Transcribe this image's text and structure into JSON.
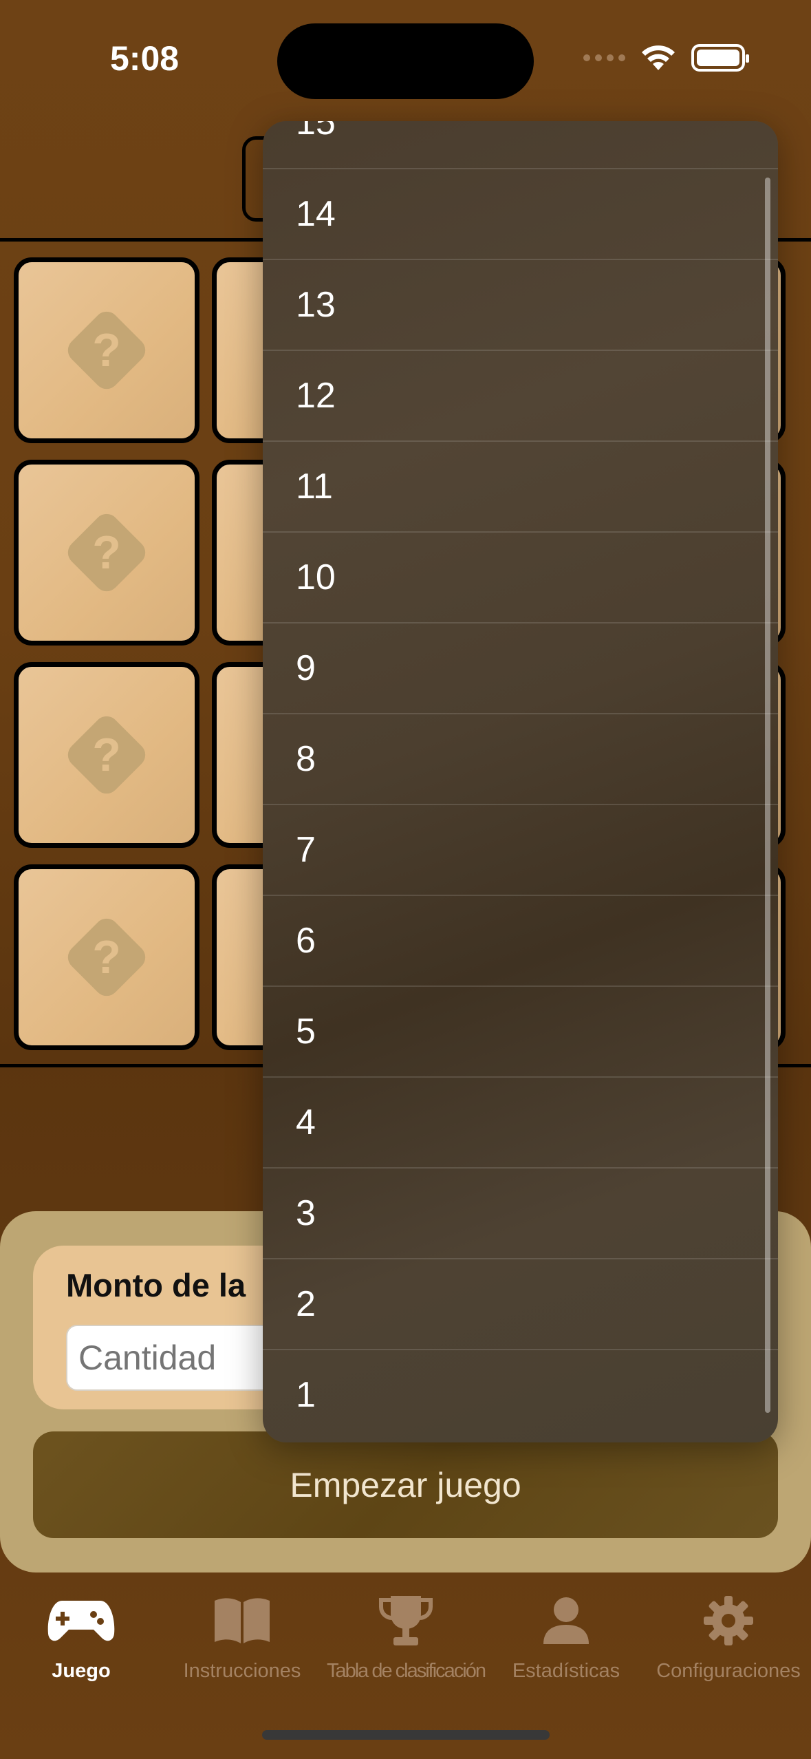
{
  "status_bar": {
    "time": "5:08"
  },
  "dropdown": {
    "options": [
      "15",
      "14",
      "13",
      "12",
      "11",
      "10",
      "9",
      "8",
      "7",
      "6",
      "5",
      "4",
      "3",
      "2",
      "1"
    ]
  },
  "bet_panel": {
    "label": "Monto de la",
    "input_placeholder": "Cantidad",
    "input_value": ""
  },
  "start_button": {
    "label": "Empezar juego"
  },
  "tabs": [
    {
      "label": "Juego",
      "icon": "gamepad-icon",
      "active": true
    },
    {
      "label": "Instrucciones",
      "icon": "book-icon",
      "active": false
    },
    {
      "label": "Tabla de clasificación",
      "icon": "trophy-icon",
      "active": false
    },
    {
      "label": "Estadísticas",
      "icon": "person-icon",
      "active": false
    },
    {
      "label": "Configuraciones",
      "icon": "gear-icon",
      "active": false
    }
  ],
  "colors": {
    "background": "#6a3f13",
    "card": "#e6bf8c",
    "panel": "#bda673",
    "dropdown": "#4a3d2e",
    "tab_inactive": "#a48262"
  }
}
